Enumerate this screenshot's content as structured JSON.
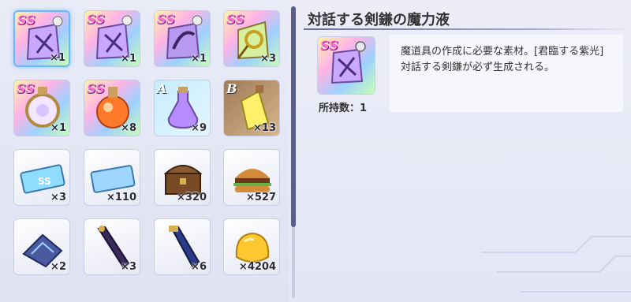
{
  "inventory": {
    "items": [
      {
        "grade": "SS",
        "count": "×1",
        "icon": "crossbow-scroll-icon",
        "selected": true
      },
      {
        "grade": "SS",
        "count": "×1",
        "icon": "crossbow-scroll-icon"
      },
      {
        "grade": "SS",
        "count": "×1",
        "icon": "sickle-scroll-icon"
      },
      {
        "grade": "SS",
        "count": "×3",
        "icon": "coil-potion-icon"
      },
      {
        "grade": "SS",
        "count": "×1",
        "icon": "compass-icon"
      },
      {
        "grade": "SS",
        "count": "×8",
        "icon": "orange-orb-potion-icon"
      },
      {
        "grade": "A",
        "count": "×9",
        "icon": "purple-potion-icon"
      },
      {
        "grade": "B",
        "count": "×13",
        "icon": "yellow-potion-icon"
      },
      {
        "grade": "",
        "count": "×3",
        "icon": "ss-ticket-icon"
      },
      {
        "grade": "",
        "count": "×110",
        "icon": "blue-ticket-icon"
      },
      {
        "grade": "",
        "count": "×320",
        "icon": "treasure-chest-icon"
      },
      {
        "grade": "",
        "count": "×527",
        "icon": "burger-icon"
      },
      {
        "grade": "",
        "count": "×2",
        "icon": "blue-crystal-shard-icon"
      },
      {
        "grade": "",
        "count": "×3",
        "icon": "dagger-icon"
      },
      {
        "grade": "",
        "count": "×6",
        "icon": "tube-icon"
      },
      {
        "grade": "",
        "count": "×4204",
        "icon": "gold-jelly-icon"
      }
    ]
  },
  "detail": {
    "title": "対話する剣鎌の魔力液",
    "grade": "SS",
    "icon": "crossbow-scroll-icon",
    "owned": "所持数：1",
    "description": "魔道具の作成に必要な素材。[君臨する紫光]対話する剣鎌が必ず生成される。"
  },
  "colors": {
    "accent": "#6fb6ff",
    "title_line": "#6b6f9a"
  }
}
